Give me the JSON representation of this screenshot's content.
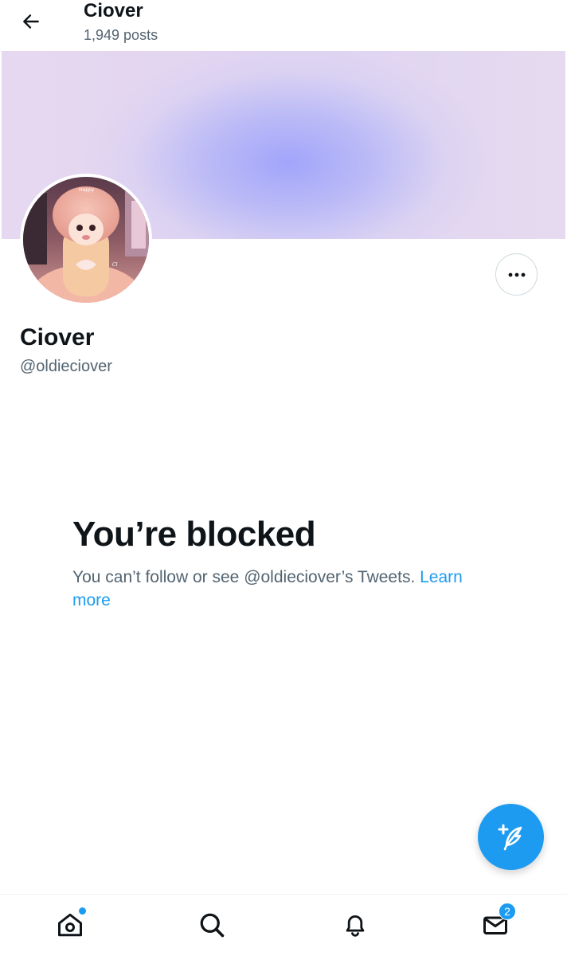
{
  "header": {
    "title": "Ciover",
    "posts_count": "1,949 posts"
  },
  "profile": {
    "display_name": "Ciover",
    "handle": "@oldieciover"
  },
  "blocked": {
    "title": "You’re blocked",
    "message": "You can’t follow or see @oldieciover’s Tweets.",
    "link_text": "Learn more"
  },
  "nav": {
    "messages_badge": "2"
  },
  "colors": {
    "accent": "#1d9bf0",
    "text_primary": "#0f1419",
    "text_secondary": "#536471"
  },
  "icons": {
    "back": "arrow-left-icon",
    "more": "ellipsis-icon",
    "compose": "feather-plus-icon",
    "home": "home-icon",
    "search": "search-icon",
    "notifications": "bell-icon",
    "messages": "envelope-icon"
  }
}
